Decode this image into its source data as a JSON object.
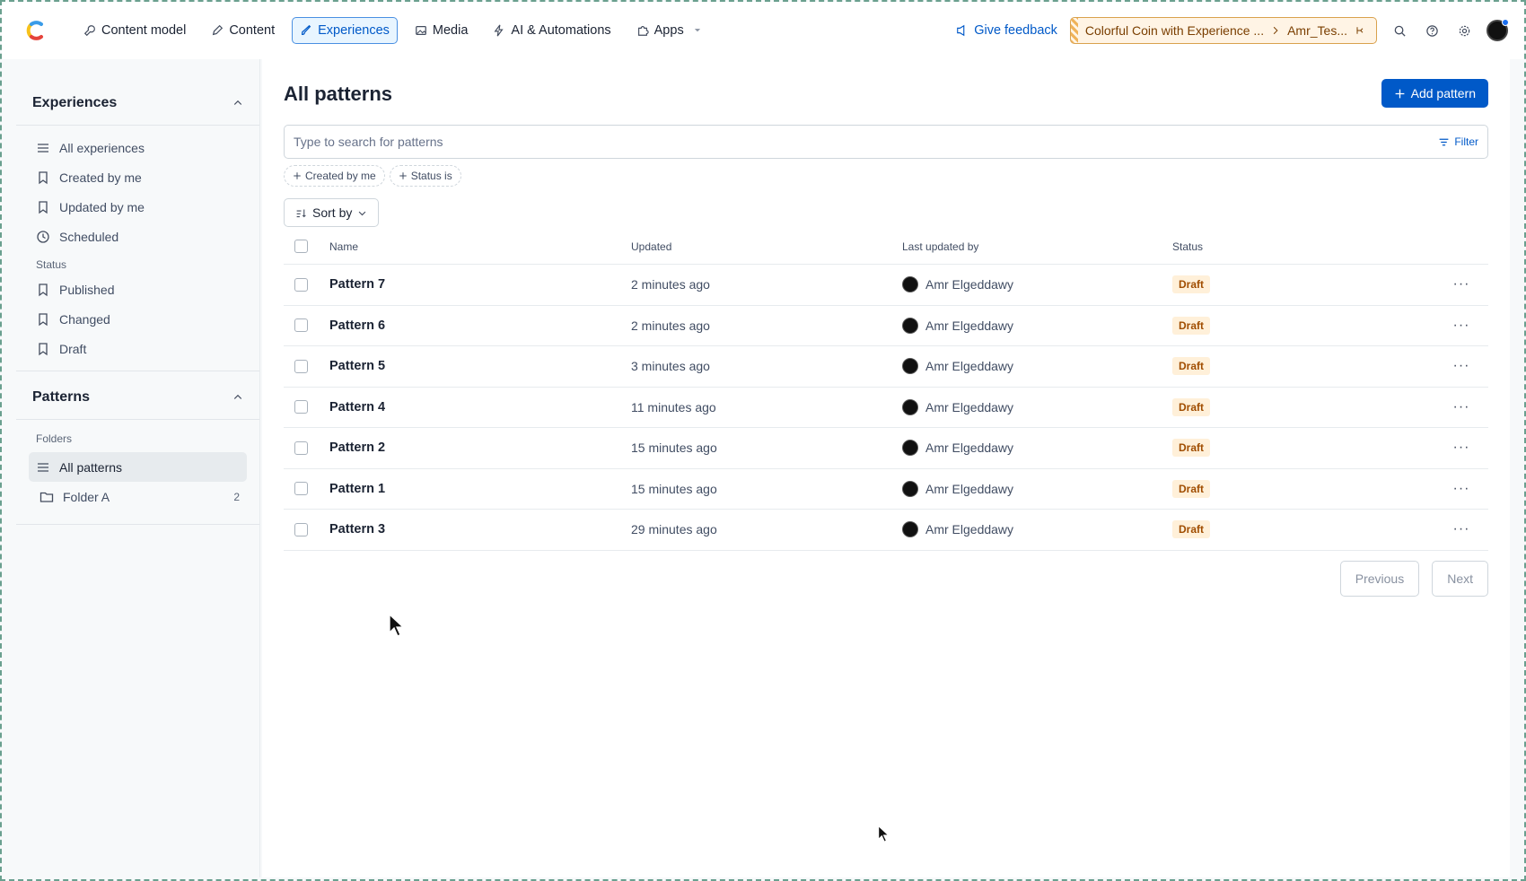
{
  "topnav": {
    "items": [
      {
        "label": "Content model",
        "icon": "wrench-icon"
      },
      {
        "label": "Content",
        "icon": "pen-icon"
      },
      {
        "label": "Experiences",
        "icon": "brush-icon",
        "active": true
      },
      {
        "label": "Media",
        "icon": "image-icon"
      },
      {
        "label": "AI & Automations",
        "icon": "bolt-icon"
      },
      {
        "label": "Apps",
        "icon": "puzzle-icon"
      }
    ],
    "feedback": "Give feedback",
    "env_space": "Colorful Coin with Experience ...",
    "env_name": "Amr_Tes...",
    "accent_color": "#0059c8",
    "env_color": "#d9a14d"
  },
  "sidebar": {
    "experiences_title": "Experiences",
    "experience_items": [
      {
        "label": "All experiences",
        "icon": "list-icon"
      },
      {
        "label": "Created by me",
        "icon": "bookmark-icon"
      },
      {
        "label": "Updated by me",
        "icon": "bookmark-icon"
      },
      {
        "label": "Scheduled",
        "icon": "clock-icon"
      }
    ],
    "status_label": "Status",
    "status_items": [
      {
        "label": "Published",
        "icon": "bookmark-icon"
      },
      {
        "label": "Changed",
        "icon": "bookmark-icon"
      },
      {
        "label": "Draft",
        "icon": "bookmark-icon"
      }
    ],
    "patterns_title": "Patterns",
    "folders_label": "Folders",
    "all_patterns": "All patterns",
    "folder_a": {
      "label": "Folder A",
      "count": "2"
    }
  },
  "main": {
    "title": "All patterns",
    "add_button": "Add pattern",
    "search_placeholder": "Type to search for patterns",
    "filter": "Filter",
    "chips": [
      "Created by me",
      "Status is"
    ],
    "sort": "Sort by",
    "columns": {
      "name": "Name",
      "updated": "Updated",
      "user": "Last updated by",
      "status": "Status"
    },
    "rows": [
      {
        "name": "Pattern 7",
        "updated": "2 minutes ago",
        "user": "Amr Elgeddawy",
        "status": "Draft"
      },
      {
        "name": "Pattern 6",
        "updated": "2 minutes ago",
        "user": "Amr Elgeddawy",
        "status": "Draft"
      },
      {
        "name": "Pattern 5",
        "updated": "3 minutes ago",
        "user": "Amr Elgeddawy",
        "status": "Draft"
      },
      {
        "name": "Pattern 4",
        "updated": "11 minutes ago",
        "user": "Amr Elgeddawy",
        "status": "Draft"
      },
      {
        "name": "Pattern 2",
        "updated": "15 minutes ago",
        "user": "Amr Elgeddawy",
        "status": "Draft"
      },
      {
        "name": "Pattern 1",
        "updated": "15 minutes ago",
        "user": "Amr Elgeddawy",
        "status": "Draft"
      },
      {
        "name": "Pattern 3",
        "updated": "29 minutes ago",
        "user": "Amr Elgeddawy",
        "status": "Draft"
      }
    ],
    "previous": "Previous",
    "next": "Next"
  }
}
